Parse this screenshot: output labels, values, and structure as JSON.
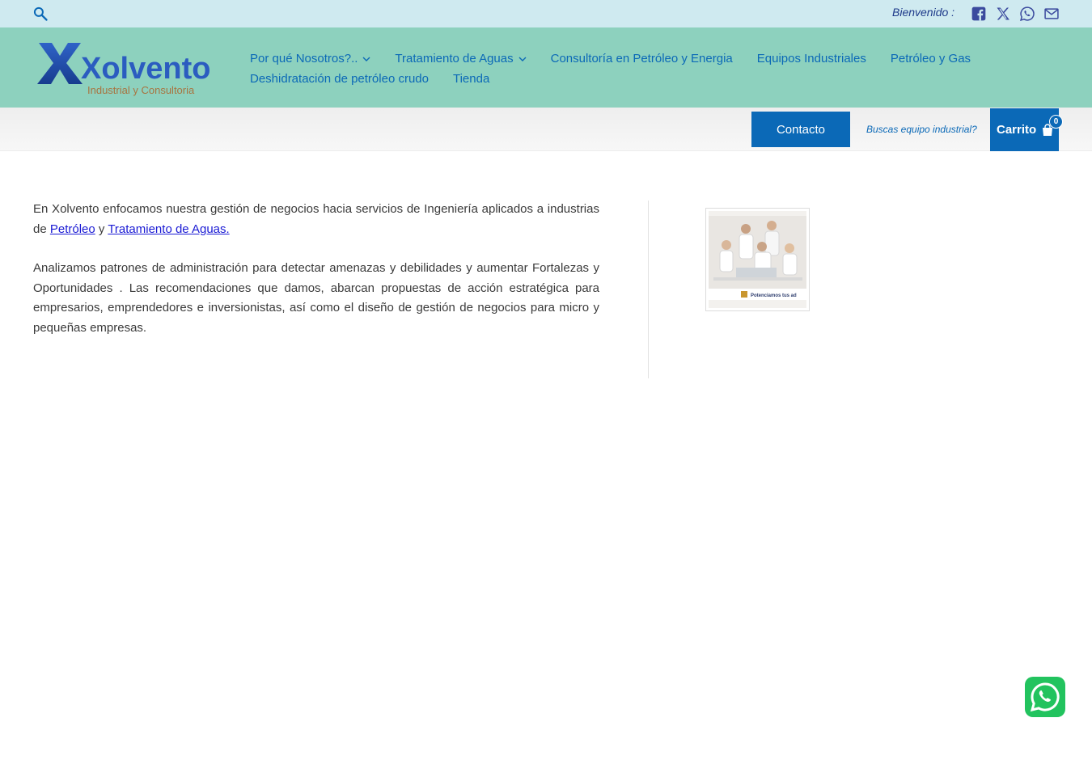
{
  "topbar": {
    "welcome": "Bienvenido :",
    "social_icons": [
      "facebook-icon",
      "x-icon",
      "whatsapp-icon",
      "email-icon"
    ]
  },
  "header": {
    "logo_text": "Xolvento",
    "logo_subtitle": "Industrial y Consultoria",
    "nav": [
      {
        "label": "Por qué Nosotros?..",
        "has_dropdown": true
      },
      {
        "label": "Tratamiento de Aguas",
        "has_dropdown": true
      },
      {
        "label": "Consultoría en Petróleo y Energia",
        "has_dropdown": false
      },
      {
        "label": "Equipos Industriales",
        "has_dropdown": false
      },
      {
        "label": "Petróleo y Gas",
        "has_dropdown": false
      },
      {
        "label": "Deshidratación de petróleo crudo",
        "has_dropdown": false
      },
      {
        "label": "Tienda",
        "has_dropdown": false
      }
    ]
  },
  "subbar": {
    "contact_label": "Contacto",
    "search_hint": "Buscas equipo industrial?",
    "cart_label": "Carrito",
    "cart_count": "0"
  },
  "content": {
    "p1_start": "En Xolvento enfocamos nuestra gestión de negocios hacia servicios de Ingeniería aplicados a industrias de ",
    "p1_link1": "Petróleo",
    "p1_mid": " y ",
    "p1_link2": "Tratamiento de Aguas.",
    "p2": "Analizamos patrones de administración para detectar amenazas y debilidades y aumentar Fortalezas y Oportunidades . Las recomendaciones que damos, abarcan propuestas de acción estratégica para empresarios, emprendedores e inversionistas, así como el diseño de gestión de negocios para micro y pequeñas empresas."
  },
  "sidebar": {
    "image_caption": "Potenciamos tus ad"
  },
  "colors": {
    "topbar_bg": "#cfeaf0",
    "header_bg": "#8dd1be",
    "primary": "#0b69b7",
    "whatsapp": "#22c35e"
  }
}
